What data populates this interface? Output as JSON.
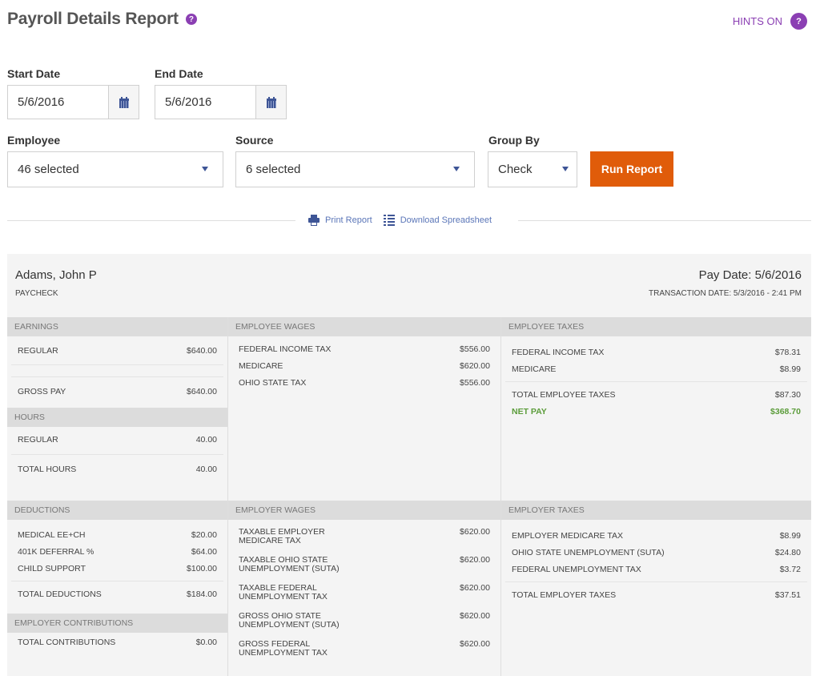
{
  "header": {
    "title": "Payroll Details Report",
    "help_icon": "question-circle-icon",
    "hints_label": "HINTS ON",
    "hints_icon": "question-circle-icon"
  },
  "filters": {
    "start_date": {
      "label": "Start Date",
      "value": "5/6/2016",
      "icon": "calendar-icon"
    },
    "end_date": {
      "label": "End Date",
      "value": "5/6/2016",
      "icon": "calendar-icon"
    },
    "employee": {
      "label": "Employee",
      "value": "46 selected"
    },
    "source": {
      "label": "Source",
      "value": "6 selected"
    },
    "group_by": {
      "label": "Group By",
      "value": "Check"
    },
    "run_button": "Run Report"
  },
  "actions": {
    "print": "Print Report",
    "download": "Download Spreadsheet"
  },
  "colors": {
    "accent_purple": "#8b3fb3",
    "run_button": "#e05c0a",
    "link_blue": "#5b76b8",
    "net_pay_green": "#5b9c3a"
  },
  "report": {
    "employee_name": "Adams, John P",
    "check_type": "PAYCHECK",
    "pay_date": "Pay Date: 5/6/2016",
    "transaction_date": "TRANSACTION DATE: 5/3/2016 - 2:41 PM",
    "earnings": {
      "title": "EARNINGS",
      "rows": [
        {
          "label": "REGULAR",
          "value": "$640.00"
        }
      ],
      "total": {
        "label": "GROSS PAY",
        "value": "$640.00"
      }
    },
    "hours": {
      "title": "HOURS",
      "rows": [
        {
          "label": "REGULAR",
          "value": "40.00"
        }
      ],
      "total": {
        "label": "TOTAL HOURS",
        "value": "40.00"
      }
    },
    "employee_wages": {
      "title": "EMPLOYEE WAGES",
      "rows": [
        {
          "label": "FEDERAL INCOME TAX",
          "value": "$556.00"
        },
        {
          "label": "MEDICARE",
          "value": "$620.00"
        },
        {
          "label": "OHIO STATE TAX",
          "value": "$556.00"
        }
      ]
    },
    "employee_taxes": {
      "title": "EMPLOYEE TAXES",
      "rows": [
        {
          "label": "FEDERAL INCOME TAX",
          "value": "$78.31"
        },
        {
          "label": "MEDICARE",
          "value": "$8.99"
        }
      ],
      "total": {
        "label": "TOTAL EMPLOYEE TAXES",
        "value": "$87.30"
      },
      "net_pay": {
        "label": "NET PAY",
        "value": "$368.70"
      }
    },
    "deductions": {
      "title": "DEDUCTIONS",
      "rows": [
        {
          "label": "MEDICAL EE+CH",
          "value": "$20.00"
        },
        {
          "label": "401K DEFERRAL %",
          "value": "$64.00"
        },
        {
          "label": "CHILD SUPPORT",
          "value": "$100.00"
        }
      ],
      "total": {
        "label": "TOTAL DEDUCTIONS",
        "value": "$184.00"
      }
    },
    "employer_contributions": {
      "title": "EMPLOYER CONTRIBUTIONS",
      "total": {
        "label": "TOTAL CONTRIBUTIONS",
        "value": "$0.00"
      }
    },
    "employer_wages": {
      "title": "EMPLOYER WAGES",
      "rows": [
        {
          "label": "TAXABLE EMPLOYER",
          "label2": "MEDICARE TAX",
          "value": "$620.00"
        },
        {
          "label": "TAXABLE OHIO STATE",
          "label2": "UNEMPLOYMENT (SUTA)",
          "value": "$620.00"
        },
        {
          "label": "TAXABLE FEDERAL",
          "label2": "UNEMPLOYMENT TAX",
          "value": "$620.00"
        },
        {
          "label": "GROSS OHIO STATE",
          "label2": "UNEMPLOYMENT (SUTA)",
          "value": "$620.00"
        },
        {
          "label": "GROSS FEDERAL",
          "label2": "UNEMPLOYMENT TAX",
          "value": "$620.00"
        }
      ]
    },
    "employer_taxes": {
      "title": "EMPLOYER TAXES",
      "rows": [
        {
          "label": "EMPLOYER MEDICARE TAX",
          "value": "$8.99"
        },
        {
          "label": "OHIO STATE UNEMPLOYMENT (SUTA)",
          "value": "$24.80"
        },
        {
          "label": "FEDERAL UNEMPLOYMENT TAX",
          "value": "$3.72"
        }
      ],
      "total": {
        "label": "TOTAL EMPLOYER TAXES",
        "value": "$37.51"
      }
    }
  }
}
